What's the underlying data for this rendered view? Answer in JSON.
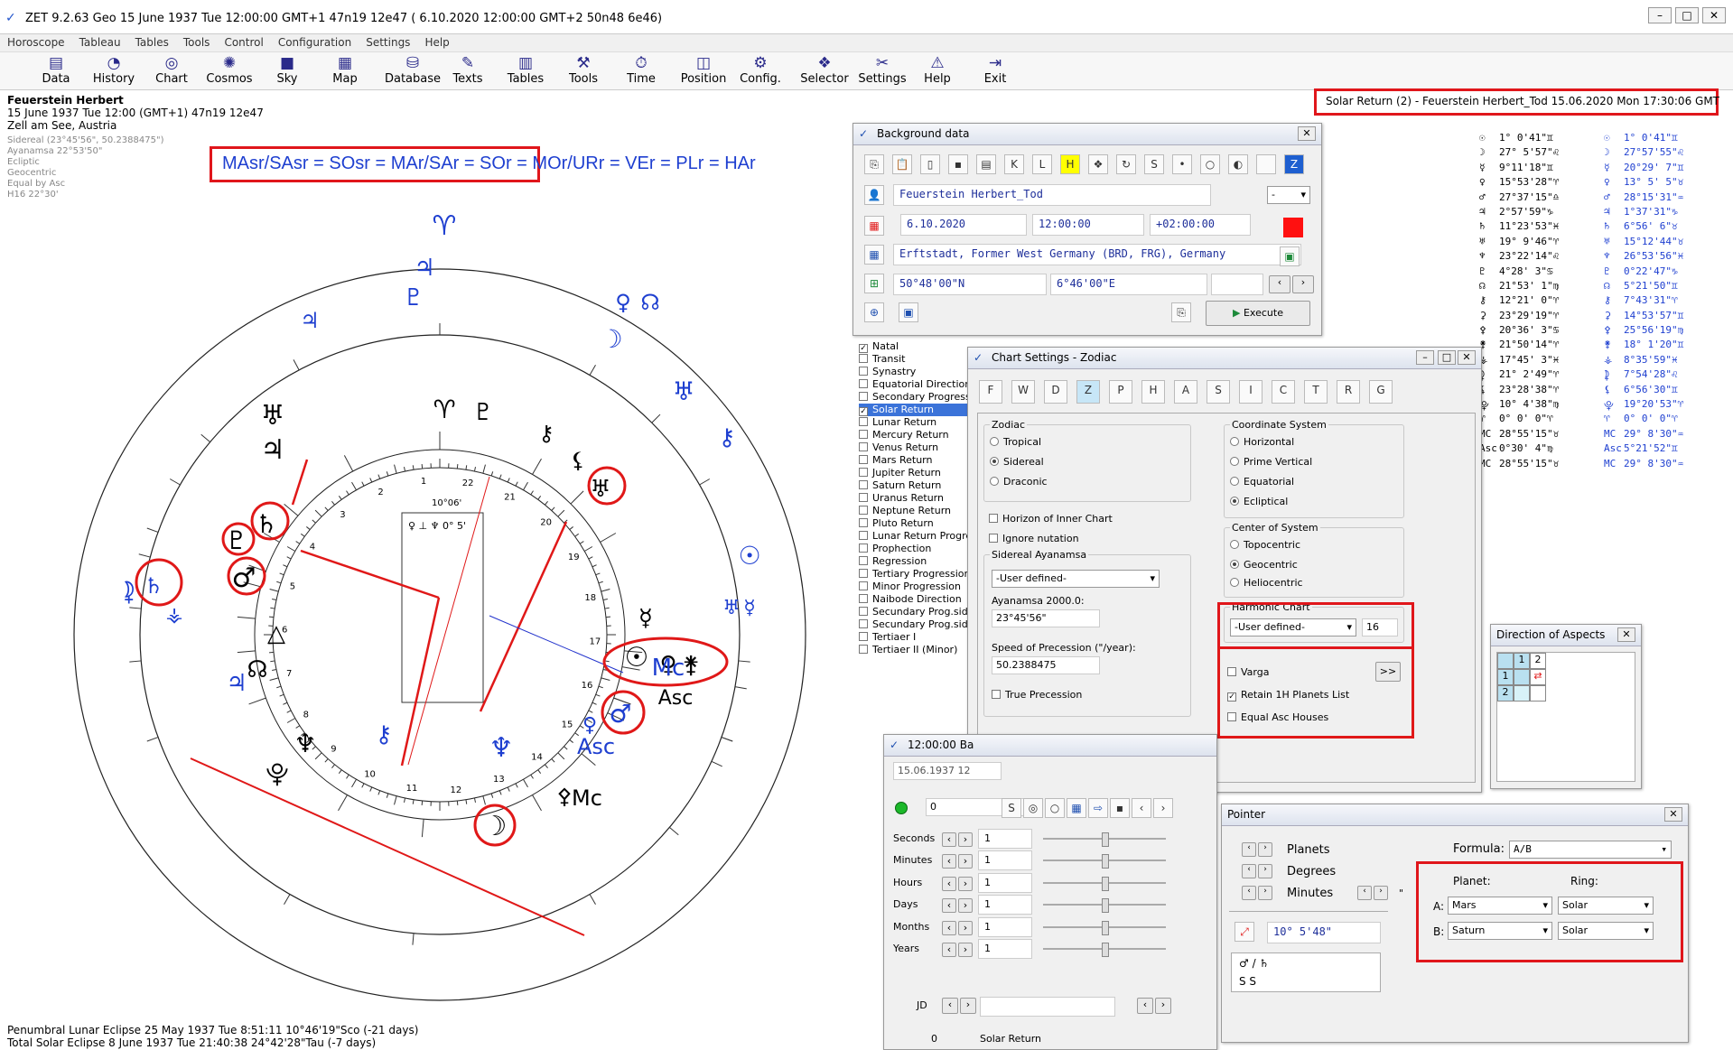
{
  "window": {
    "title": "ZET 9.2.63 Geo    15 June 1937  Tue  12:00:00 GMT+1 47n19  12e47   ( 6.10.2020  12:00:00 GMT+2 50n48 6e46)"
  },
  "menu": [
    "Horoscope",
    "Tableau",
    "Tables",
    "Tools",
    "Control",
    "Configuration",
    "Settings",
    "Help"
  ],
  "toolbar": [
    "Data",
    "History",
    "Chart",
    "Cosmos",
    "Sky",
    "Map",
    "Database",
    "Texts",
    "Tables",
    "Tools",
    "Time",
    "Position",
    "Config.",
    "Selector",
    "Settings",
    "Help",
    "Exit"
  ],
  "header_info": {
    "name": "Feuerstein Herbert",
    "date_line": "15 June 1937  Tue   12:00 (GMT+1) 47n19  12e47",
    "place": "Zell am See, Austria",
    "settings": [
      "Sidereal (23°45'56\", 50.2388475\")",
      "Ayanamsa 22°53'50\"",
      "Ecliptic",
      "Geocentric",
      "Equal by Asc",
      "H16  22°30'"
    ]
  },
  "formula_boxed": "MAsr/SAsr = SOsr = MAr/SAr = SOr",
  "formula_rest": " = MOr/URr = VEr = PLr = HAr",
  "return_label": "Solar Return (2) - Feuerstein Herbert_Tod 15.06.2020  Mon 17:30:06 GMT",
  "chart": {
    "center_box_label": "10°06'",
    "center_box_text": "♀ ⊥ ♆   0° 5'",
    "inner_numbers": [
      "1",
      "2",
      "3",
      "4",
      "5",
      "6",
      "7",
      "8",
      "9",
      "10",
      "11",
      "12",
      "13",
      "14",
      "15",
      "16",
      "17",
      "18",
      "19",
      "20",
      "21",
      "22"
    ],
    "asc_label": "Asc",
    "mc_label": "Mc"
  },
  "footer": {
    "line1": "Penumbral Lunar Eclipse 25 May 1937 Tue   8:51:11 10°46'19\"Sco (-21 days)",
    "line2": "Total Solar Eclipse 8 June 1937 Tue 21:40:38 24°42'28\"Tau (-7 days)"
  },
  "positions": [
    [
      "☉",
      "1° 0'41\"♊",
      "☉",
      "1° 0'41\"♊"
    ],
    [
      "☽",
      "27° 5'57\"♌",
      "☽",
      "27°57'55\"♌"
    ],
    [
      "☿",
      "9°11'18\"♊",
      "☿",
      "20°29' 7\"♊"
    ],
    [
      "♀",
      "15°53'28\"♈",
      "♀",
      "13° 5' 5\"♉"
    ],
    [
      "♂",
      "27°37'15\"♎",
      "♂",
      "28°15'31\"♒"
    ],
    [
      "♃",
      "2°57'59\"♑",
      "♃",
      "1°37'31\"♑"
    ],
    [
      "♄",
      "11°23'53\"♓",
      "♄",
      "6°56' 6\"♉"
    ],
    [
      "♅",
      "19° 9'46\"♈",
      "♅",
      "15°12'44\"♉"
    ],
    [
      "♆",
      "23°22'14\"♌",
      "♆",
      "26°53'56\"♓"
    ],
    [
      "♇",
      "4°28' 3\"♋",
      "♇",
      "0°22'47\"♑"
    ],
    [
      "☊",
      "21°53' 1\"♍",
      "☊",
      "5°21'50\"♊"
    ],
    [
      "⚷",
      "12°21' 0\"♈",
      "⚷",
      "7°43'31\"♈"
    ],
    [
      "⚳",
      "23°29'19\"♈",
      "⚳",
      "14°53'57\"♊"
    ],
    [
      "⚴",
      "20°36' 3\"♋",
      "⚴",
      "25°56'19\"♍"
    ],
    [
      "⚵",
      "21°50'14\"♈",
      "⚵",
      "18° 1'20\"♊"
    ],
    [
      "⚶",
      "17°45' 3\"♓",
      "⚶",
      "8°35'59\"♓"
    ],
    [
      "⯝",
      "21° 2'49\"♈",
      "⯝",
      "7°54'28\"♌"
    ],
    [
      "⚸",
      "23°28'38\"♈",
      "⚸",
      "6°56'30\"♊"
    ],
    [
      "⯓",
      "10° 4'38\"♍",
      "⯓",
      "19°20'53\"♈"
    ],
    [
      "♈",
      "0° 0' 0\"♈",
      "♈",
      "0° 0' 0\"♈"
    ],
    [
      "MC",
      "28°55'15\"♉",
      "MC",
      "29° 8'30\"♒"
    ],
    [
      "Asc",
      "0°30' 4\"♍",
      "Asc",
      "5°21'52\"♊"
    ],
    [
      "MC",
      "28°55'15\"♉",
      "MC",
      "29° 8'30\"♒"
    ]
  ],
  "background_data": {
    "title": "Background data",
    "name": "Feuerstein Herbert_Tod",
    "dash": "-",
    "date": "6.10.2020",
    "time": "12:00:00",
    "tz": "+02:00:00",
    "place": "Erftstadt, Former West Germany (BRD, FRG), Germany",
    "lat": "50°48'00\"N",
    "lon": "6°46'00\"E",
    "execute": "Execute"
  },
  "chart_types": [
    "Natal",
    "Transit",
    "Synastry",
    "Equatorial Direction",
    "Secondary Progression",
    "Solar Return",
    "Lunar Return",
    "Mercury Return",
    "Venus Return",
    "Mars Return",
    "Jupiter Return",
    "Saturn Return",
    "Uranus Return",
    "Neptune Return",
    "Pluto Return",
    "Lunar Return Progress.",
    "Prophection",
    "Regression",
    "Tertiary Progression",
    "Minor Progression",
    "Naibode Direction",
    "Secundary Prog.sid.",
    "Secundary Prog.sid-c",
    "Tertiaer I",
    "Tertiaer II (Minor)"
  ],
  "chart_settings": {
    "title": "Chart Settings - Zodiac",
    "tabs": [
      "F",
      "W",
      "D",
      "Z",
      "P",
      "H",
      "A",
      "S",
      "I",
      "C",
      "T",
      "R",
      "G"
    ],
    "zodiac_label": "Zodiac",
    "zodiac": [
      "Tropical",
      "Sidereal",
      "Draconic"
    ],
    "horizon": "Horizon of Inner Chart",
    "ignore_nutation": "Ignore nutation",
    "sidereal_label": "Sidereal Ayanamsa",
    "ayan_select": "-User defined-",
    "ayan_2000_label": "Ayanamsa 2000.0:",
    "ayan_2000": "23°45'56\"",
    "speed_label": "Speed of Precession (\"/year):",
    "speed": "50.2388475",
    "true_precession": "True Precession",
    "coord_label": "Coordinate System",
    "coord": [
      "Horizontal",
      "Prime Vertical",
      "Equatorial",
      "Ecliptical"
    ],
    "center_label": "Center of System",
    "center": [
      "Topocentric",
      "Geocentric",
      "Heliocentric"
    ],
    "harmonic_label": "Harmonic Chart",
    "harmonic_select": "-User defined-",
    "harmonic_value": "16",
    "varga": "Varga",
    "varga_btn": ">>",
    "retain": "Retain 1H Planets List",
    "equal_asc": "Equal Asc Houses"
  },
  "direction_aspects": {
    "title": "Direction of Aspects",
    "cols": [
      "1",
      "2"
    ],
    "rows": [
      "1",
      "2"
    ]
  },
  "time_panel": {
    "title": "12:00:00 Ba",
    "date": "15.06.1937  12",
    "zero": "0",
    "rows": [
      [
        "Seconds",
        "1"
      ],
      [
        "Minutes",
        "1"
      ],
      [
        "Hours",
        "1"
      ],
      [
        "Days",
        "1"
      ],
      [
        "Months",
        "1"
      ],
      [
        "Years",
        "1"
      ]
    ],
    "jd": "JD",
    "status_zero": "0",
    "status": "Solar Return"
  },
  "pointer": {
    "title": "Pointer",
    "planets": "Planets",
    "degrees": "Degrees",
    "minutes": "Minutes",
    "quote": "\"",
    "formula_label": "Formula:",
    "formula": "A/B",
    "planet_label": "Planet:",
    "ring_label": "Ring:",
    "a_label": "A:",
    "b_label": "B:",
    "a_planet": "Mars",
    "b_planet": "Saturn",
    "a_ring": "Solar",
    "b_ring": "Solar",
    "value": "10° 5'48\"",
    "pair": "♂ / ♄",
    "ss": "S   S"
  }
}
